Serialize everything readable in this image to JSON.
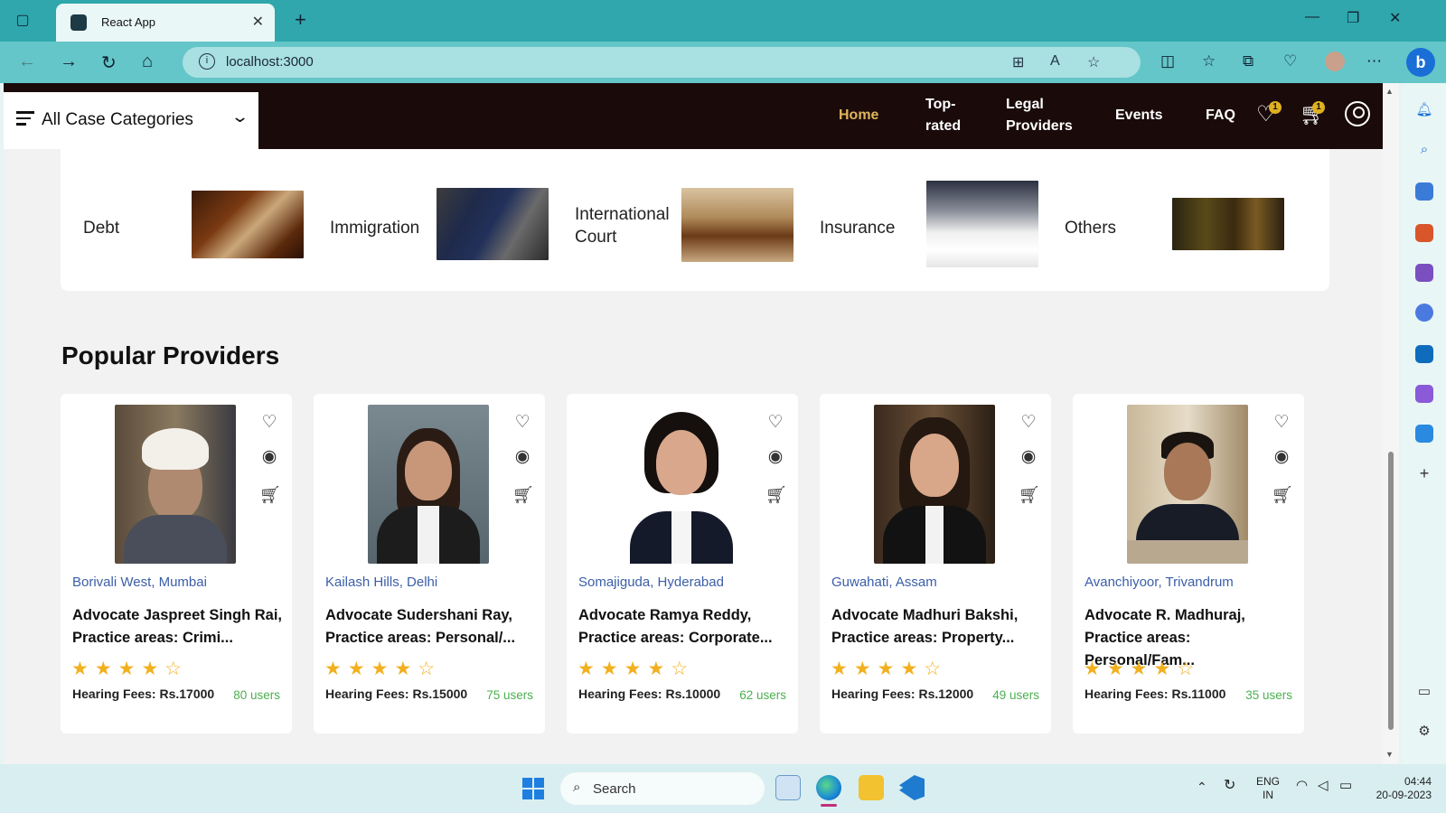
{
  "browser": {
    "tab_title": "React App",
    "tab_close": "✕",
    "new_tab": "+",
    "url": "localhost:3000"
  },
  "header": {
    "category_dropdown": "All Case Categories",
    "nav": {
      "home": "Home",
      "top_rated_1": "Top-",
      "top_rated_2": "rated",
      "legal_1": "Legal",
      "legal_2": "Providers",
      "events": "Events",
      "faq": "FAQ"
    },
    "wishlist_count": "1",
    "cart_count": "1"
  },
  "categories": [
    {
      "label": "Debt",
      "image": "gavel-money-photo"
    },
    {
      "label": "Immigration",
      "image": "passport-gavel-photo"
    },
    {
      "label_1": "International",
      "label_2": "Court",
      "image": "international-law-book-photo"
    },
    {
      "label": "Insurance",
      "image": "family-protection-photo"
    },
    {
      "label": "Others",
      "image": "law-books-gavel-photo"
    }
  ],
  "section_title": "Popular Providers",
  "providers": [
    {
      "location": "Borivali West, Mumbai",
      "name_1": "Advocate Jaspreet Singh Rai,",
      "name_2": "Practice areas: Crimi...",
      "rating": 4,
      "stars": "★★★★☆",
      "fees": "Hearing Fees: Rs.17000",
      "users": "80 users"
    },
    {
      "location": "Kailash Hills, Delhi",
      "name_1": "Advocate Sudershani Ray,",
      "name_2": "Practice areas: Personal/...",
      "rating": 4,
      "stars": "★★★★☆",
      "fees": "Hearing Fees: Rs.15000",
      "users": "75 users"
    },
    {
      "location": "Somajiguda, Hyderabad",
      "name_1": "Advocate Ramya Reddy,",
      "name_2": "Practice areas: Corporate...",
      "rating": 4,
      "stars": "★★★★☆",
      "fees": "Hearing Fees: Rs.10000",
      "users": "62 users"
    },
    {
      "location": "Guwahati, Assam",
      "name_1": "Advocate Madhuri Bakshi,",
      "name_2": "Practice areas: Property...",
      "rating": 4,
      "stars": "★★★★☆",
      "fees": "Hearing Fees: Rs.12000",
      "users": "49 users"
    },
    {
      "location": "Avanchiyoor, Trivandrum",
      "name_1": "Advocate R. Madhuraj,",
      "name_2": "Practice areas: Personal/Fam...",
      "rating": 4,
      "stars": "★★★★☆",
      "fees": "Hearing Fees: Rs.11000",
      "users": "35 users"
    }
  ],
  "taskbar": {
    "search": "Search",
    "lang_1": "ENG",
    "lang_2": "IN",
    "time": "04:44",
    "date": "20-09-2023"
  },
  "colors": {
    "header_bg": "#1a0a0a",
    "nav_active": "#e0b45c",
    "location_link": "#3b5ea8",
    "star": "#f2b01e",
    "users_count": "#4caf50",
    "browser_tabbar": "#2fa7ad"
  }
}
